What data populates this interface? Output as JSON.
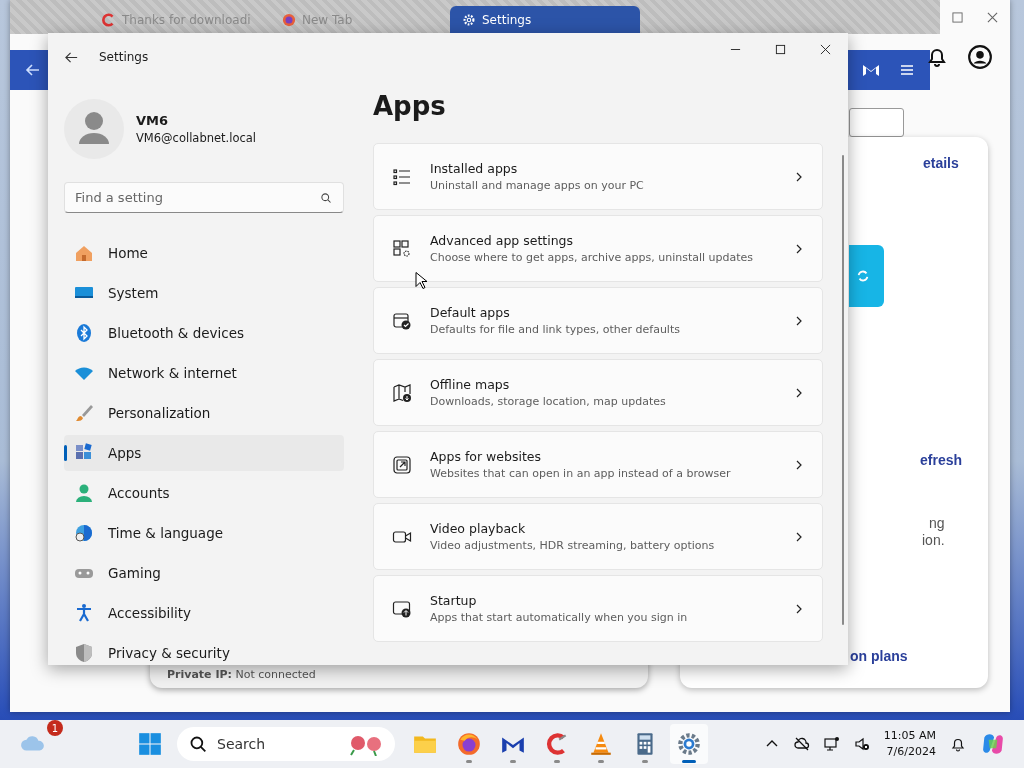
{
  "browser": {
    "tabs": [
      {
        "label": "Thanks for downloadi",
        "selected": false
      },
      {
        "label": "New Tab",
        "selected": false
      },
      {
        "label": "Settings",
        "selected": true
      }
    ],
    "content": {
      "link_1": "etails",
      "link_2": "efresh",
      "text_1": "ng",
      "text_2": "ion.",
      "link_3": "on plans",
      "private_ip": {
        "label": "Private IP:",
        "value": "Not connected"
      }
    }
  },
  "settings": {
    "title": "Settings",
    "user": {
      "name": "VM6",
      "email": "VM6@collabnet.local"
    },
    "search": {
      "placeholder": "Find a setting"
    },
    "nav": [
      {
        "label": "Home",
        "selected": false
      },
      {
        "label": "System",
        "selected": false
      },
      {
        "label": "Bluetooth & devices",
        "selected": false
      },
      {
        "label": "Network & internet",
        "selected": false
      },
      {
        "label": "Personalization",
        "selected": false
      },
      {
        "label": "Apps",
        "selected": true
      },
      {
        "label": "Accounts",
        "selected": false
      },
      {
        "label": "Time & language",
        "selected": false
      },
      {
        "label": "Gaming",
        "selected": false
      },
      {
        "label": "Accessibility",
        "selected": false
      },
      {
        "label": "Privacy & security",
        "selected": false
      }
    ],
    "heading": "Apps",
    "items": [
      {
        "title": "Installed apps",
        "subtitle": "Uninstall and manage apps on your PC"
      },
      {
        "title": "Advanced app settings",
        "subtitle": "Choose where to get apps, archive apps, uninstall updates"
      },
      {
        "title": "Default apps",
        "subtitle": "Defaults for file and link types, other defaults"
      },
      {
        "title": "Offline maps",
        "subtitle": "Downloads, storage location, map updates"
      },
      {
        "title": "Apps for websites",
        "subtitle": "Websites that can open in an app instead of a browser"
      },
      {
        "title": "Video playback",
        "subtitle": "Video adjustments, HDR streaming, battery options"
      },
      {
        "title": "Startup",
        "subtitle": "Apps that start automatically when you sign in"
      }
    ]
  },
  "taskbar": {
    "weather_badge": "1",
    "search": {
      "placeholder": "Search"
    },
    "apps": [
      {
        "running": false,
        "active": false
      },
      {
        "running": true,
        "active": false
      },
      {
        "running": true,
        "active": false
      },
      {
        "running": true,
        "active": false
      },
      {
        "running": true,
        "active": false
      },
      {
        "running": true,
        "active": false
      },
      {
        "running": true,
        "active": true
      }
    ],
    "clock": {
      "time": "11:05 AM",
      "date": "7/6/2024"
    }
  }
}
